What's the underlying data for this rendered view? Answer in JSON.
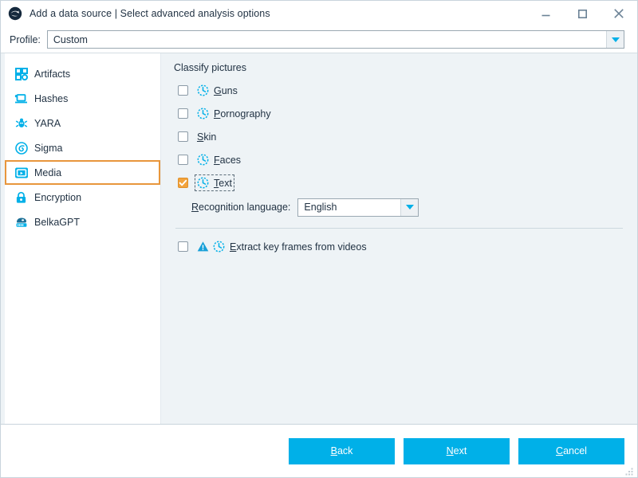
{
  "window": {
    "title": "Add a data source | Select advanced analysis options",
    "logo_icon": "belkasoft-logo-icon",
    "controls": {
      "minimize": "minimize-icon",
      "maximize": "maximize-icon",
      "close": "close-icon"
    }
  },
  "profile": {
    "label": "Profile:",
    "value": "Custom",
    "placeholder": "Custom",
    "arrow_icon": "chevron-down-icon"
  },
  "sidebar": {
    "items": [
      {
        "label": "Artifacts",
        "icon": "grid-squares-icon",
        "selected": false
      },
      {
        "label": "Hashes",
        "icon": "laptop-icon",
        "selected": false
      },
      {
        "label": "YARA",
        "icon": "bug-icon",
        "selected": false
      },
      {
        "label": "Sigma",
        "icon": "spiral-icon",
        "selected": false
      },
      {
        "label": "Media",
        "icon": "video-film-icon",
        "selected": true
      },
      {
        "label": "Encryption",
        "icon": "padlock-icon",
        "selected": false
      },
      {
        "label": "BelkaGPT",
        "icon": "robot-icon",
        "selected": false
      }
    ]
  },
  "main": {
    "group_title": "Classify pictures",
    "options": [
      {
        "label": "Guns",
        "mnemonic": "G",
        "checked": false,
        "clock": true,
        "focused": false
      },
      {
        "label": "Pornography",
        "mnemonic": "P",
        "checked": false,
        "clock": true,
        "focused": false
      },
      {
        "label": "Skin",
        "mnemonic": "S",
        "checked": false,
        "clock": false,
        "focused": false
      },
      {
        "label": "Faces",
        "mnemonic": "F",
        "checked": false,
        "clock": true,
        "focused": false
      },
      {
        "label": "Text",
        "mnemonic": "T",
        "checked": true,
        "clock": true,
        "focused": true
      }
    ],
    "language": {
      "label": "Recognition language:",
      "mnemonic": "R",
      "value": "English",
      "arrow_icon": "chevron-down-icon"
    },
    "video": {
      "label": "Extract key frames from videos",
      "mnemonic": "E",
      "checked": false,
      "warning_icon": "warning-triangle-icon",
      "clock_icon": "clock-icon"
    }
  },
  "footer": {
    "buttons": [
      {
        "label": "Back",
        "mnemonic": "B"
      },
      {
        "label": "Next",
        "mnemonic": "N"
      },
      {
        "label": "Cancel",
        "mnemonic": "C"
      }
    ],
    "resize_grip": "resize-grip-icon"
  },
  "colors": {
    "accent": "#00b0e8",
    "selection": "#e8963c",
    "checked": "#f2a33c",
    "panel_bg": "#eef3f6",
    "text": "#223344"
  }
}
